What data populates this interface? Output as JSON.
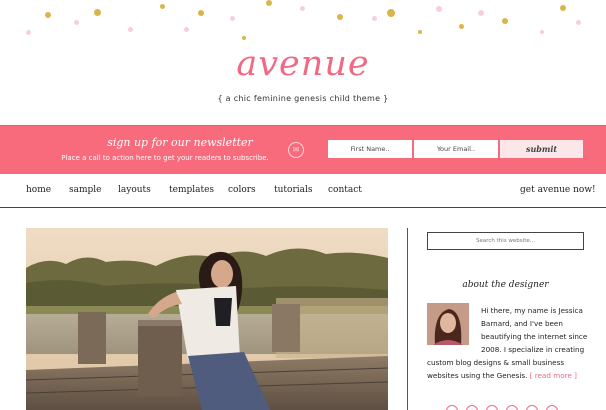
{
  "header": {
    "title": "avenue",
    "description": "{ a chic feminine genesis child theme }"
  },
  "newsletter": {
    "title": "sign up for our newsletter",
    "subtitle": "Place a call to action here to get your readers to subscribe.",
    "first_name_placeholder": "First Name..",
    "email_placeholder": "Your Email..",
    "submit_label": "submit"
  },
  "nav": {
    "items": [
      "home",
      "sample",
      "layouts",
      "templates",
      "colors",
      "tutorials",
      "contact"
    ],
    "cta": "get avenue now!"
  },
  "sidebar": {
    "search_placeholder": "Search this website...",
    "about_title": "about the designer",
    "about_lines": [
      "Hi there, my name is Jessica",
      "Barnard, and I've been",
      "beautifying the internet since",
      "2008. I specialize in creating",
      "custom blog designs & small business",
      "websites using the Genesis."
    ],
    "read_more": "[ read more ]"
  },
  "colors": {
    "accent": "#f76b7c",
    "title_pink": "#f06a85",
    "gold": "#d9b54a"
  }
}
